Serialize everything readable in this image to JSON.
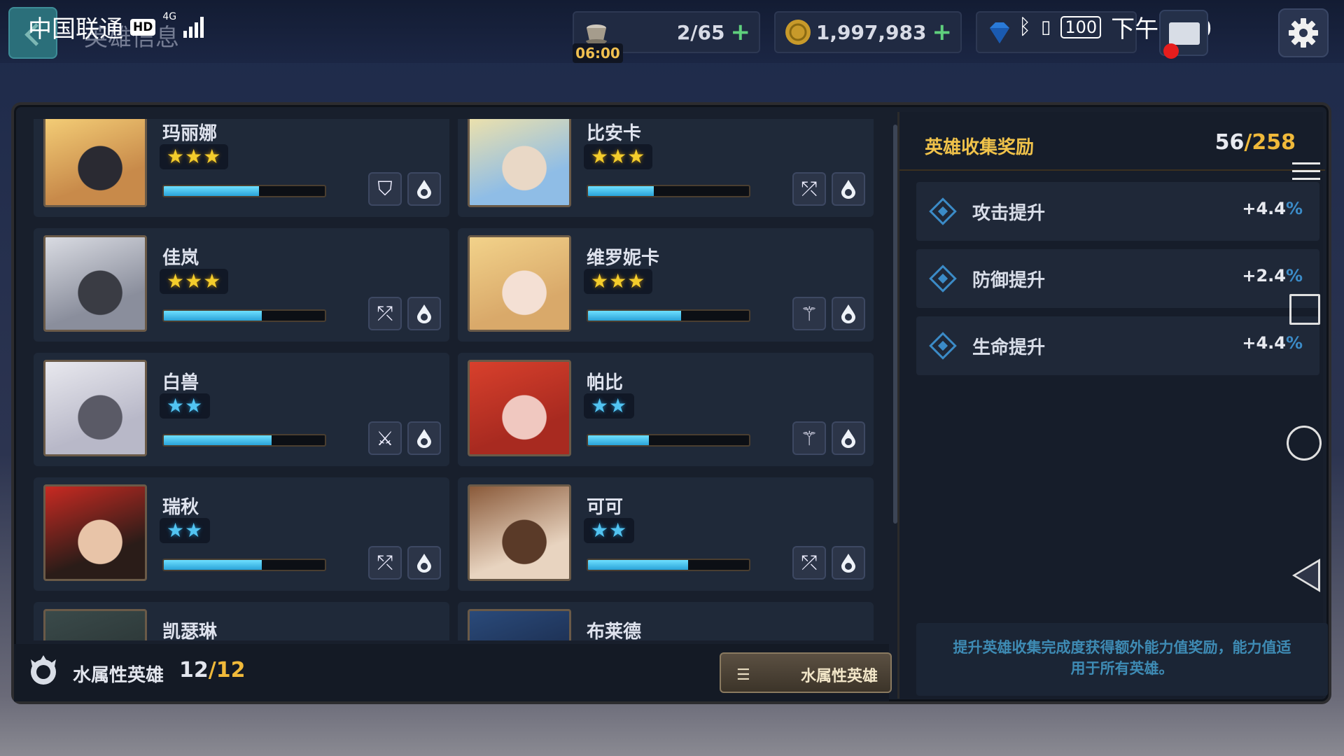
{
  "status_bar": {
    "carrier": "中国联通",
    "hd": "HD",
    "network": "4G",
    "battery": "100",
    "time": "下午4:29"
  },
  "header": {
    "title": "英雄信息"
  },
  "resources": {
    "stamina": "2/65",
    "stamina_timer": "06:00",
    "gold": "1,997,983",
    "gems": ""
  },
  "heroes": [
    {
      "name": "玛丽娜",
      "stars": "★★★",
      "star_type": "gold",
      "progress": 0.59,
      "class_icon": "shield-icon",
      "element_icon": "water-drop-icon",
      "portrait_colors": [
        "#f6d179",
        "#c88a4a",
        "#2a2a32"
      ]
    },
    {
      "name": "比安卡",
      "stars": "★★★",
      "star_type": "gold",
      "progress": 0.41,
      "class_icon": "crossed-bow-icon",
      "element_icon": "water-drop-icon",
      "portrait_colors": [
        "#f2e3a8",
        "#8fbde6",
        "#e9d8c6"
      ]
    },
    {
      "name": "佳岚",
      "stars": "★★★",
      "star_type": "gold",
      "progress": 0.61,
      "class_icon": "crossed-bow-icon",
      "element_icon": "water-drop-icon",
      "portrait_colors": [
        "#d9dbe2",
        "#8a8e9c",
        "#3a3c44"
      ]
    },
    {
      "name": "维罗妮卡",
      "stars": "★★★",
      "star_type": "gold",
      "progress": 0.58,
      "class_icon": "staff-icon",
      "element_icon": "water-drop-icon",
      "portrait_colors": [
        "#f2d28a",
        "#d9a96a",
        "#f4e0d4"
      ]
    },
    {
      "name": "白兽",
      "stars": "★★",
      "star_type": "blue",
      "progress": 0.67,
      "class_icon": "crossed-swords-icon",
      "element_icon": "water-drop-icon",
      "portrait_colors": [
        "#e8e8ee",
        "#b8b8c8",
        "#5a5a66"
      ]
    },
    {
      "name": "帕比",
      "stars": "★★",
      "star_type": "blue",
      "progress": 0.38,
      "class_icon": "staff-icon",
      "element_icon": "water-drop-icon",
      "portrait_colors": [
        "#d8402c",
        "#a82a20",
        "#f0c8c0"
      ]
    },
    {
      "name": "瑞秋",
      "stars": "★★",
      "star_type": "blue",
      "progress": 0.61,
      "class_icon": "crossed-bow-icon",
      "element_icon": "water-drop-icon",
      "portrait_colors": [
        "#c82a22",
        "#2a1c18",
        "#e8c4a8"
      ]
    },
    {
      "name": "可可",
      "stars": "★★",
      "star_type": "blue",
      "progress": 0.62,
      "class_icon": "crossed-bow-icon",
      "element_icon": "water-drop-icon",
      "portrait_colors": [
        "#8a5a3a",
        "#e8d4c0",
        "#5a3a28"
      ]
    },
    {
      "name": "凯瑟琳",
      "stars": "",
      "star_type": "blue",
      "progress": 0,
      "class_icon": "",
      "element_icon": "",
      "portrait_colors": [
        "#3a4a4a",
        "#2a3434",
        "#1a2222"
      ]
    },
    {
      "name": "布莱德",
      "stars": "",
      "star_type": "blue",
      "progress": 0,
      "class_icon": "",
      "element_icon": "",
      "portrait_colors": [
        "#2a4a7a",
        "#1a2a4a",
        "#0a1a2a"
      ]
    }
  ],
  "footer": {
    "attr_label": "水属性英雄",
    "count": "12",
    "total": "/12",
    "filter_label": "水属性英雄"
  },
  "reward_panel": {
    "title": "英雄收集奖励",
    "count": "56",
    "total": "/258",
    "stats": [
      {
        "name": "攻击提升",
        "value": "+4.4",
        "unit": "%"
      },
      {
        "name": "防御提升",
        "value": "+2.4",
        "unit": "%"
      },
      {
        "name": "生命提升",
        "value": "+4.4",
        "unit": "%"
      }
    ],
    "description_line1": "提升英雄收集完成度获得额外能力值奖励，能力值适",
    "description_line2": "用于所有英雄。"
  },
  "colors": {
    "accent_gold": "#f0b93a",
    "accent_blue": "#3b8bc7",
    "progress_fill": "#2aa3d8"
  }
}
